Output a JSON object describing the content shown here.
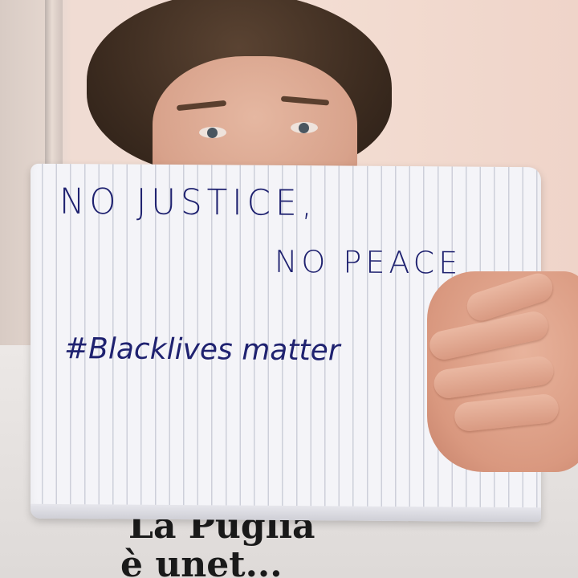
{
  "sign": {
    "line1": "NO  JUSTICE,",
    "line2": "NO  PEACE",
    "line3": "#Blacklives matter"
  },
  "shirt_print": {
    "text_line1": "La Puglia",
    "text_line2": "è unet..."
  },
  "colors": {
    "ink": "#1f2270",
    "wall": "#f0dcd3",
    "paper": "#f4f4f8",
    "shirt": "#ece8e6"
  }
}
